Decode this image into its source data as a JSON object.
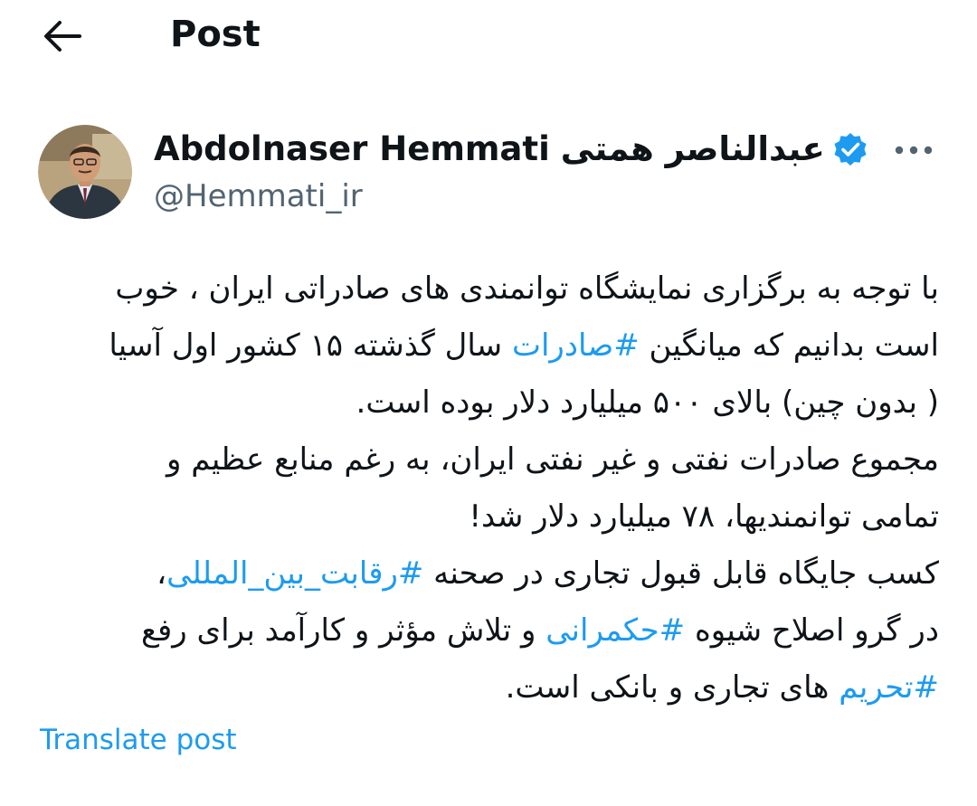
{
  "header": {
    "back_icon": "arrow-left-icon",
    "title": "Post"
  },
  "author": {
    "name_en": "Abdolnaser Hemmati",
    "name_fa": "عبدالناصر همتی",
    "handle": "@Hemmati_ir",
    "verified_icon": "verified-badge-icon",
    "more_icon": "more-dots-icon"
  },
  "tweet": {
    "line1": "با توجه به برگزاری نمایشگاه توانمندی های صادراتی ایران ، خوب",
    "line2_a": "است بدانیم که میانگین ",
    "line2_tag": "#صادرات",
    "line2_b": " سال گذشته ۱۵ کشور اول آسیا",
    "line3": "( بدون چین) بالای ۵۰۰ میلیارد دلار بوده است.",
    "line4": "مجموع صادرات نفتی و غیر نفتی ایران، به رغم منابع عظیم و",
    "line5": "تمامی توانمندیها، ۷۸ میلیارد دلار شد!",
    "line6_a": " کسب جایگاه قابل قبول تجاری در صحنه ",
    "line6_tag": "#رقابت_بین_المللی",
    "line6_b": "،",
    "line7_a": "در گرو اصلاح شیوه ",
    "line7_tag": "#حکمرانی",
    "line7_b": "  و تلاش مؤثر و کارآمد برای رفع",
    "line8_tag": "#تحریم",
    "line8_b": " های تجاری و بانکی است."
  },
  "translate_label": "Translate post",
  "colors": {
    "text": "#0f1419",
    "secondary": "#536471",
    "link": "#1d9bf0"
  }
}
